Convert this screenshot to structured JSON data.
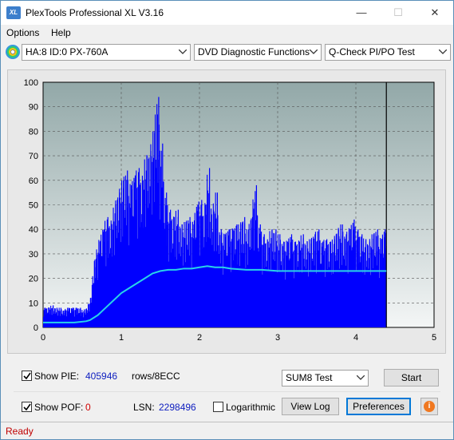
{
  "window": {
    "title": "PlexTools Professional XL V3.16",
    "logo_text": "XL"
  },
  "controls": {
    "minimize": "—",
    "maximize": "☐",
    "close": "✕"
  },
  "menu": [
    "Options",
    "Help"
  ],
  "toolbar": {
    "drive": "HA:8 ID:0  PX-760A",
    "function": "DVD Diagnostic Functions",
    "test": "Q-Check PI/PO Test"
  },
  "chart_data": {
    "type": "area",
    "background_gradient": [
      "#92a8a8",
      "#f4f6f6"
    ],
    "series_color": "#0000ff",
    "line_color": "#29d3e8",
    "xlim": [
      0,
      5
    ],
    "ylim": [
      0,
      100
    ],
    "x_ticks": [
      "0",
      "1",
      "2",
      "3",
      "4",
      "5"
    ],
    "y_ticks": [
      "0",
      "10",
      "20",
      "30",
      "40",
      "50",
      "60",
      "70",
      "80",
      "90",
      "100"
    ],
    "end_marker_x": 4.39,
    "series": [
      {
        "kind": "bars",
        "x": [
          0.0,
          0.05,
          0.1,
          0.15,
          0.2,
          0.25,
          0.3,
          0.35,
          0.4,
          0.45,
          0.5,
          0.55,
          0.6,
          0.65,
          0.7,
          0.75,
          0.8,
          0.85,
          0.9,
          0.95,
          1.0,
          1.05,
          1.1,
          1.15,
          1.2,
          1.25,
          1.3,
          1.35,
          1.4,
          1.45,
          1.5,
          1.55,
          1.6,
          1.65,
          1.7,
          1.75,
          1.8,
          1.85,
          1.9,
          1.95,
          2.0,
          2.05,
          2.1,
          2.15,
          2.2,
          2.25,
          2.3,
          2.35,
          2.4,
          2.45,
          2.5,
          2.55,
          2.6,
          2.65,
          2.7,
          2.75,
          2.8,
          2.85,
          2.9,
          2.95,
          3.0,
          3.05,
          3.1,
          3.15,
          3.2,
          3.25,
          3.3,
          3.35,
          3.4,
          3.45,
          3.5,
          3.55,
          3.6,
          3.65,
          3.7,
          3.75,
          3.8,
          3.85,
          3.9,
          3.95,
          4.0,
          4.05,
          4.1,
          4.15,
          4.2,
          4.25,
          4.3,
          4.35,
          4.39
        ],
        "values": [
          8,
          8,
          9,
          8,
          8,
          7,
          8,
          8,
          8,
          8,
          7,
          8,
          12,
          28,
          35,
          40,
          45,
          42,
          50,
          55,
          60,
          64,
          58,
          62,
          65,
          60,
          70,
          72,
          80,
          94,
          75,
          55,
          48,
          45,
          48,
          42,
          43,
          45,
          42,
          50,
          52,
          46,
          65,
          48,
          55,
          40,
          38,
          40,
          40,
          42,
          42,
          45,
          40,
          45,
          58,
          42,
          38,
          35,
          40,
          40,
          38,
          35,
          35,
          38,
          35,
          35,
          38,
          35,
          36,
          38,
          40,
          35,
          36,
          35,
          36,
          40,
          42,
          38,
          40,
          44,
          40,
          38,
          36,
          35,
          38,
          40,
          36,
          40,
          38
        ]
      },
      {
        "kind": "line",
        "x": [
          0.0,
          0.2,
          0.4,
          0.55,
          0.6,
          0.7,
          0.8,
          0.9,
          1.0,
          1.1,
          1.2,
          1.3,
          1.4,
          1.5,
          1.6,
          1.7,
          1.8,
          1.9,
          2.0,
          2.1,
          2.2,
          2.3,
          2.4,
          2.6,
          2.8,
          3.0,
          3.2,
          3.4,
          3.6,
          3.8,
          4.0,
          4.2,
          4.39
        ],
        "values": [
          2,
          2,
          2,
          2.5,
          3,
          5,
          8,
          11,
          14,
          16,
          18,
          20,
          22,
          23,
          23.5,
          23.5,
          24,
          24,
          24.5,
          25,
          24.5,
          24.5,
          24,
          23.5,
          23.5,
          23,
          23,
          23,
          23,
          23,
          23,
          23,
          23
        ]
      }
    ]
  },
  "bottom": {
    "show_pie_label": "Show PIE:",
    "pie_value": "405946",
    "rows_label": "rows/8ECC",
    "show_poe_label": "Show POF:",
    "poe_value": "0",
    "lsn_label": "LSN:",
    "lsn_value": "2298496",
    "logarithmic_label": "Logarithmic",
    "test_select": "SUM8 Test",
    "start": "Start",
    "view_log": "View Log",
    "preferences": "Preferences",
    "info_icon_text": "i"
  },
  "status": "Ready"
}
